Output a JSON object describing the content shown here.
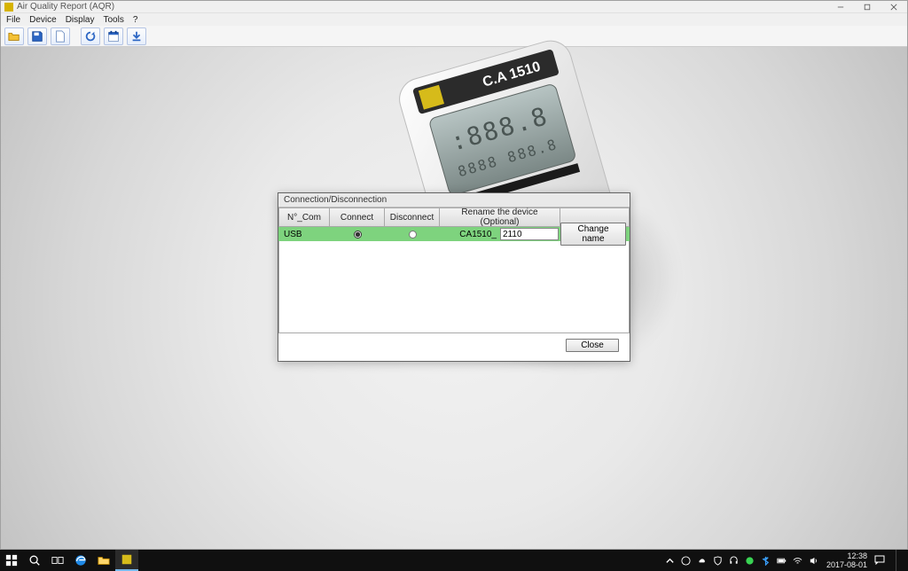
{
  "title_bar": {
    "title": "Air Quality Report (AQR)"
  },
  "menu": {
    "items": [
      "File",
      "Device",
      "Display",
      "Tools",
      "?"
    ]
  },
  "toolbar": {
    "icons": [
      "open",
      "save",
      "new-doc",
      "refresh",
      "calendar",
      "download"
    ]
  },
  "dialog": {
    "title": "Connection/Disconnection",
    "headers": {
      "com": "N°_Com",
      "connect": "Connect",
      "disconnect": "Disconnect",
      "rename": "Rename the device (Optional)"
    },
    "row": {
      "com": "USB",
      "connect_selected": true,
      "disconnect_selected": false,
      "rename_prefix": "CA1510_",
      "rename_value": "2110",
      "change_label": "Change name"
    },
    "close_label": "Close"
  },
  "taskbar": {
    "time": "12:38",
    "date": "2017-08-01"
  }
}
